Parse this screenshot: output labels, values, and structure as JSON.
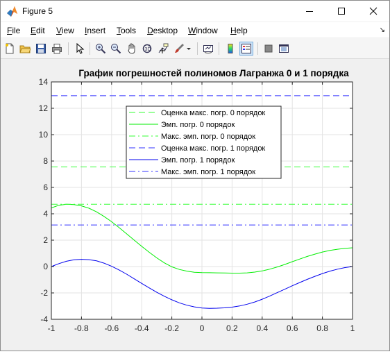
{
  "window": {
    "title": "Figure 5"
  },
  "menu": [
    "File",
    "Edit",
    "View",
    "Insert",
    "Tools",
    "Desktop",
    "Window",
    "Help"
  ],
  "toolbar_icons": [
    "new-figure-icon",
    "open-file-icon",
    "save-icon",
    "print-icon",
    "select-arrow-icon",
    "zoom-in-icon",
    "zoom-out-icon",
    "pan-icon",
    "rotate-3d-icon",
    "data-cursor-icon",
    "brush-icon",
    "brush-dropdown-icon",
    "link-plot-icon",
    "insert-colorbar-icon",
    "insert-legend-icon",
    "hide-plot-tools-icon",
    "show-plot-tools-icon"
  ],
  "chart_data": {
    "type": "line",
    "title": "График погрешностей полиномов Лагранжа 0 и 1 порядка",
    "xlabel": "",
    "ylabel": "",
    "xlim": [
      -1,
      1
    ],
    "ylim": [
      -4,
      14
    ],
    "xticks": [
      -1,
      -0.8,
      -0.6,
      -0.4,
      -0.2,
      0,
      0.2,
      0.4,
      0.6,
      0.8,
      1
    ],
    "xtick_labels": [
      "-1",
      "-0.8",
      "-0.6",
      "-0.4",
      "-0.2",
      "0",
      "0.2",
      "0.4",
      "0.6",
      "0.8",
      "1"
    ],
    "yticks": [
      -4,
      -2,
      0,
      2,
      4,
      6,
      8,
      10,
      12,
      14
    ],
    "ytick_labels": [
      "-4",
      "-2",
      "0",
      "2",
      "4",
      "6",
      "8",
      "10",
      "12",
      "14"
    ],
    "grid": true,
    "legend_position": "top-center",
    "series": [
      {
        "name": "Оценка макс. погр. 0 порядок",
        "color": "#33ff33",
        "dash": "dashed",
        "x": [
          -1,
          1
        ],
        "y": [
          7.55,
          7.55
        ]
      },
      {
        "name": "Эмп. погр. 0 порядок",
        "color": "#00ee00",
        "dash": "solid",
        "x": [
          -1,
          -0.95,
          -0.9,
          -0.85,
          -0.8,
          -0.75,
          -0.7,
          -0.65,
          -0.6,
          -0.55,
          -0.5,
          -0.45,
          -0.4,
          -0.35,
          -0.3,
          -0.25,
          -0.2,
          -0.15,
          -0.1,
          -0.05,
          0,
          0.05,
          0.1,
          0.15,
          0.2,
          0.25,
          0.3,
          0.35,
          0.4,
          0.45,
          0.5,
          0.55,
          0.6,
          0.65,
          0.7,
          0.75,
          0.8,
          0.85,
          0.9,
          0.95,
          1
        ],
        "y": [
          4.45,
          4.65,
          4.72,
          4.7,
          4.6,
          4.42,
          4.15,
          3.8,
          3.4,
          2.95,
          2.48,
          2.0,
          1.53,
          1.08,
          0.66,
          0.28,
          -0.02,
          -0.22,
          -0.35,
          -0.43,
          -0.46,
          -0.47,
          -0.48,
          -0.49,
          -0.5,
          -0.5,
          -0.48,
          -0.42,
          -0.33,
          -0.2,
          -0.03,
          0.16,
          0.37,
          0.57,
          0.77,
          0.94,
          1.1,
          1.22,
          1.31,
          1.38,
          1.42
        ]
      },
      {
        "name": "Макс. эмп. погр. 0 порядок",
        "color": "#33ff33",
        "dash": "dashdot",
        "x": [
          -1,
          1
        ],
        "y": [
          4.72,
          4.72
        ]
      },
      {
        "name": "Оценка макс. погр. 1 порядок",
        "color": "#3333ff",
        "dash": "dashed",
        "x": [
          -1,
          1
        ],
        "y": [
          12.95,
          12.95
        ]
      },
      {
        "name": "Эмп. погр. 1 порядок",
        "color": "#0000ee",
        "dash": "solid",
        "x": [
          -1,
          -0.95,
          -0.9,
          -0.85,
          -0.8,
          -0.75,
          -0.7,
          -0.65,
          -0.6,
          -0.55,
          -0.5,
          -0.45,
          -0.4,
          -0.35,
          -0.3,
          -0.25,
          -0.2,
          -0.15,
          -0.1,
          -0.05,
          0,
          0.05,
          0.1,
          0.15,
          0.2,
          0.25,
          0.3,
          0.35,
          0.4,
          0.45,
          0.5,
          0.55,
          0.6,
          0.65,
          0.7,
          0.75,
          0.8,
          0.85,
          0.9,
          0.95,
          1
        ],
        "y": [
          0.0,
          0.22,
          0.4,
          0.51,
          0.55,
          0.52,
          0.43,
          0.26,
          0.02,
          -0.26,
          -0.58,
          -0.93,
          -1.28,
          -1.62,
          -1.95,
          -2.25,
          -2.52,
          -2.75,
          -2.93,
          -3.06,
          -3.14,
          -3.17,
          -3.16,
          -3.13,
          -3.08,
          -2.99,
          -2.86,
          -2.69,
          -2.48,
          -2.24,
          -1.98,
          -1.72,
          -1.46,
          -1.21,
          -0.97,
          -0.74,
          -0.53,
          -0.35,
          -0.2,
          -0.08,
          0.0
        ]
      },
      {
        "name": "Макс. эмп. погр. 1 порядок",
        "color": "#3333ff",
        "dash": "dashdot",
        "x": [
          -1,
          1
        ],
        "y": [
          3.15,
          3.15
        ]
      }
    ]
  }
}
